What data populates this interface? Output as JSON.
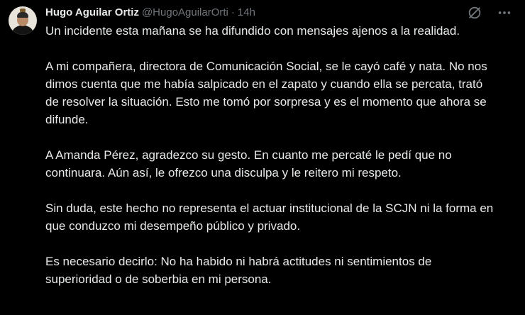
{
  "tweet": {
    "author_name": "Hugo Aguilar Ortiz",
    "author_handle": "@HugoAguilarOrti",
    "separator": "·",
    "time": "14h",
    "icons": {
      "grok": "grok-icon",
      "more": "more-icon"
    },
    "paragraphs": [
      "Un incidente esta mañana se ha difundido con mensajes ajenos a la realidad.",
      "A mi compañera, directora de Comunicación Social, se le cayó café y nata. No nos dimos cuenta que me había salpicado en el zapato y cuando ella se percata, trató de resolver la situación. Esto me tomó por sorpresa y es el momento que ahora se difunde.",
      "A Amanda Pérez, agradezco su gesto. En cuanto me percaté le pedí que no continuara. Aún así, le ofrezco una disculpa y le reitero mi respeto.",
      "Sin duda, este hecho no representa el actuar institucional de la SCJN ni la forma en que conduzco mi desempeño público y privado.",
      "Es necesario decirlo: No ha habido ni habrá actitudes ni sentimientos de superioridad o de soberbia en mi persona."
    ]
  },
  "colors": {
    "background": "#000000",
    "text_primary": "#e7e9ea",
    "text_secondary": "#71767b"
  }
}
